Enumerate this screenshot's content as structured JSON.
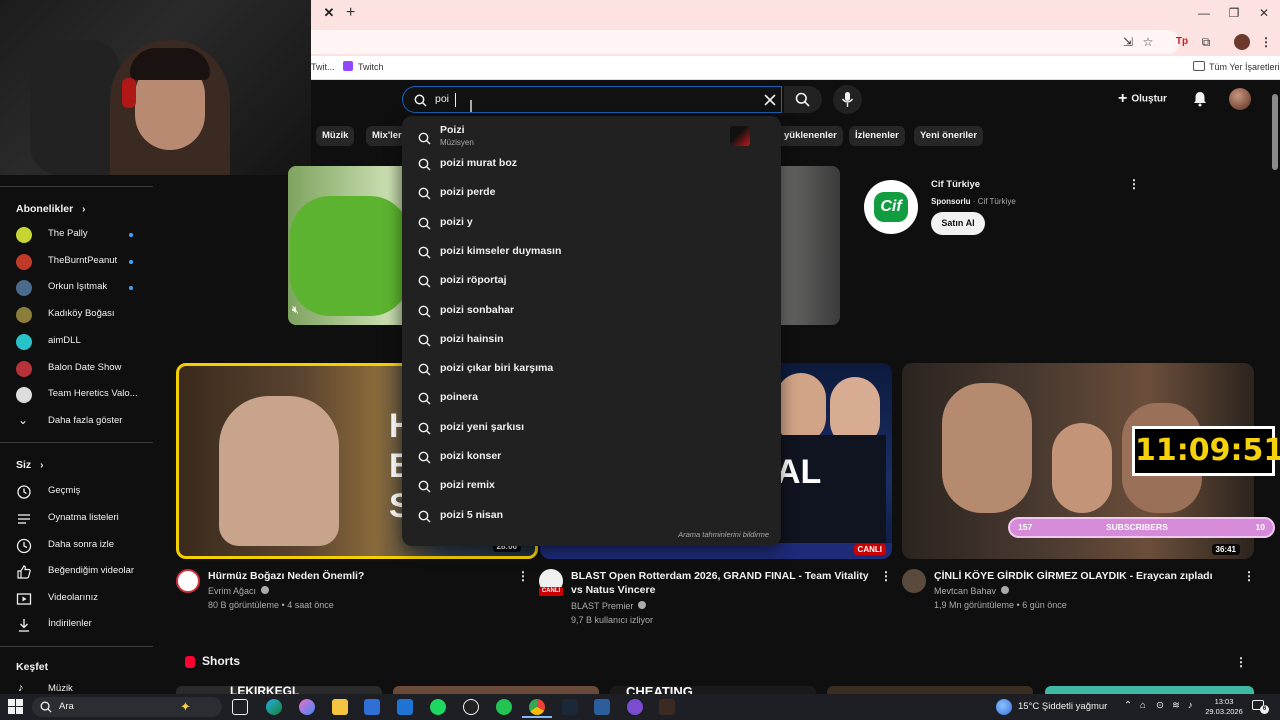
{
  "browser": {
    "bookmarks": [
      "Twit...",
      "Twitch",
      "Tüm Yer İşaretleri"
    ]
  },
  "youtube": {
    "search_value": "poi",
    "create_label": "Oluştur",
    "chips": [
      "Müzik",
      "Mix'ler",
      "yüklenenler",
      "İzlenenler",
      "Yeni öneriler"
    ],
    "suggestions_first": {
      "title": "Poizi",
      "subtitle": "Müzisyen"
    },
    "suggestions": [
      "poizi murat boz",
      "poizi perde",
      "poizi y",
      "poizi kimseler duymasın",
      "poizi röportaj",
      "poizi sonbahar",
      "poizi hainsin",
      "poizi çıkar biri karşıma",
      "poinera",
      "poizi yeni şarkısı",
      "poizi konser",
      "poizi remix",
      "poizi 5 nisan"
    ],
    "suggestions_report": "Arama tahminlerini bildirme"
  },
  "sidebar": {
    "subs_heading": "Abonelikler",
    "subs": [
      {
        "label": "The Pally",
        "dot": true,
        "color": "#c6d531"
      },
      {
        "label": "TheBurntPeanut",
        "dot": true,
        "color": "#c0392b"
      },
      {
        "label": "Orkun Işıtmak",
        "dot": true,
        "color": "#4a6b8c"
      },
      {
        "label": "Kadıköy Boğası",
        "dot": false,
        "color": "#8b7d3a"
      },
      {
        "label": "aimDLL",
        "dot": false,
        "color": "#27c3c9"
      },
      {
        "label": "Balon Date Show",
        "dot": false,
        "color": "#b8323a"
      },
      {
        "label": "Team Heretics Valo...",
        "dot": false,
        "color": "#dddddd"
      }
    ],
    "show_more": "Daha fazla göster",
    "you_heading": "Siz",
    "you": [
      "Geçmiş",
      "Oynatma listeleri",
      "Daha sonra izle",
      "Beğendiğim videolar",
      "Videolarınız",
      "İndirilenler"
    ],
    "explore_heading": "Keşfet",
    "explore": [
      "Müzik"
    ]
  },
  "ad": {
    "title": "Cif Türkiye",
    "sponsor": "Sponsorlu",
    "channel": "Cif Türkiye",
    "cta": "Satın Al",
    "logo_text": "Cif"
  },
  "videos": [
    {
      "title": "Hürmüz Boğazı Neden Önemli?",
      "channel": "Evrim Ağacı",
      "meta": "80 B görüntüleme • 4 saat önce",
      "duration": "28:06"
    },
    {
      "title": "BLAST Open Rotterdam 2026, GRAND FINAL - Team Vitality vs Natus Vincere",
      "channel": "BLAST Premier",
      "meta": "9,7 B kullanıcı izliyor",
      "badge": "CANLI",
      "avatar_label": "CANLI"
    },
    {
      "title": "ÇİNLİ KÖYE GİRDİK GİRMEZ OLAYDIK - Eraycan zıpladı",
      "channel": "Mevtcan Bahav",
      "meta": "1,9 Mn görüntüleme • 6 gün önce",
      "duration": "36:41"
    }
  ],
  "overlay": {
    "clock": "11:09:51",
    "subs_count": "157",
    "subs_label": "SUBSCRIBERS",
    "subs_goal": "10"
  },
  "shorts": {
    "heading": "Shorts",
    "thumb_texts": [
      "LEKIRKEGL",
      "CHEATING"
    ]
  },
  "taskbar": {
    "search_label": "Ara",
    "weather": "15°C  Şiddetli yağmur",
    "time": "13:03",
    "date": "29.03.2026",
    "notification_count": "6"
  },
  "colors": {
    "accent": "#3ea6ff",
    "live": "#cc0000",
    "focus": "#1c62b9"
  }
}
